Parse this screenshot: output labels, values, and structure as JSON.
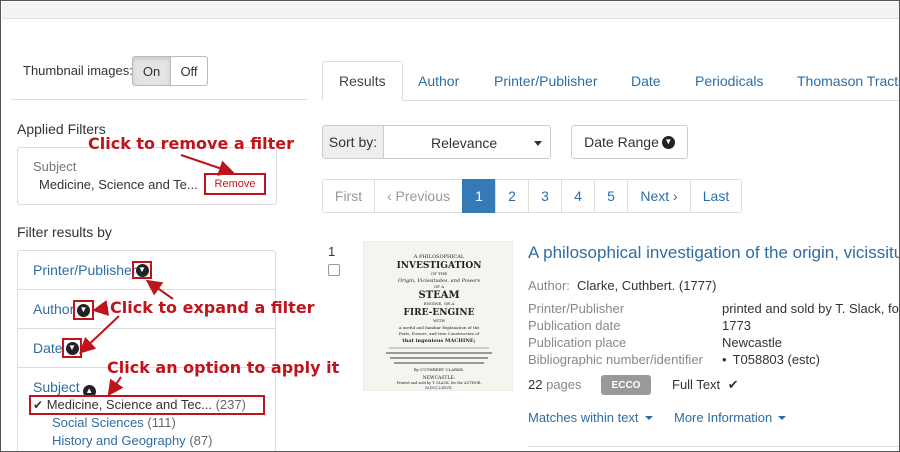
{
  "thumbnail": {
    "label": "Thumbnail images:",
    "on": "On",
    "off": "Off"
  },
  "applied_filters": {
    "heading": "Applied Filters",
    "category": "Subject",
    "value": "Medicine, Science and Te...",
    "remove_label": "Remove"
  },
  "filter_results": {
    "heading": "Filter results by",
    "items": [
      {
        "label": "Printer/Publisher"
      },
      {
        "label": "Author"
      },
      {
        "label": "Date"
      },
      {
        "label": "Subject"
      }
    ],
    "subject_options": [
      {
        "label": "Medicine, Science and Tec...",
        "count": "(237)"
      },
      {
        "label": "Social Sciences",
        "count": "(111)"
      },
      {
        "label": "History and Geography",
        "count": "(87)"
      }
    ]
  },
  "annotations": {
    "remove": "Click to remove a filter",
    "expand": "Click to expand a filter",
    "apply": "Click an option to apply it"
  },
  "tabs": [
    {
      "label": "Results"
    },
    {
      "label": "Author"
    },
    {
      "label": "Printer/Publisher"
    },
    {
      "label": "Date"
    },
    {
      "label": "Periodicals"
    },
    {
      "label": "Thomason Tracts"
    }
  ],
  "sort": {
    "label": "Sort by:",
    "value": "Relevance",
    "date_range": "Date Range"
  },
  "pagination": {
    "first": "First",
    "previous": "‹ Previous",
    "pages": [
      "1",
      "2",
      "3",
      "4",
      "5"
    ],
    "next": "Next ›",
    "last": "Last",
    "current": "1"
  },
  "result": {
    "number": "1",
    "title": "A philosophical investigation of the origin, vicissitudes",
    "thumbnail_lines": [
      "A PHILOSOPHICAL",
      "INVESTIGATION",
      "OF THE",
      "Origin, Vicissitudes, and Powers",
      "OF A",
      "STEAM",
      "ENGINE, OR A",
      "FIRE-ENGINE",
      "WITH",
      "A useful and familiar Explanation of the",
      "Parts, Powers, and true Construction of",
      "that ingenious MACHINE;",
      "By CUTHBERT CLARKE.",
      "NEWCASTLE:",
      "Printed and sold by T. SLACK, for the AUTHOR.",
      "M,DCC,LXXVII."
    ],
    "author_key": "Author:",
    "author_value": "Clarke, Cuthbert. (1777)",
    "fields": [
      {
        "key": "Printer/Publisher",
        "value": "printed and sold by T. Slack, for the"
      },
      {
        "key": "Publication date",
        "value": "1773"
      },
      {
        "key": "Publication place",
        "value": "Newcastle"
      },
      {
        "key": "Bibliographic number/identifier",
        "value": "T058803 (estc)"
      }
    ],
    "pages": "22",
    "pages_unit": "pages",
    "badge": "ECCO",
    "full_text": "Full Text",
    "matches": "Matches within text",
    "more_info": "More Information"
  },
  "colors": {
    "accent": "#337ab7",
    "link": "#2e6da4",
    "annotation": "#c0141c"
  }
}
